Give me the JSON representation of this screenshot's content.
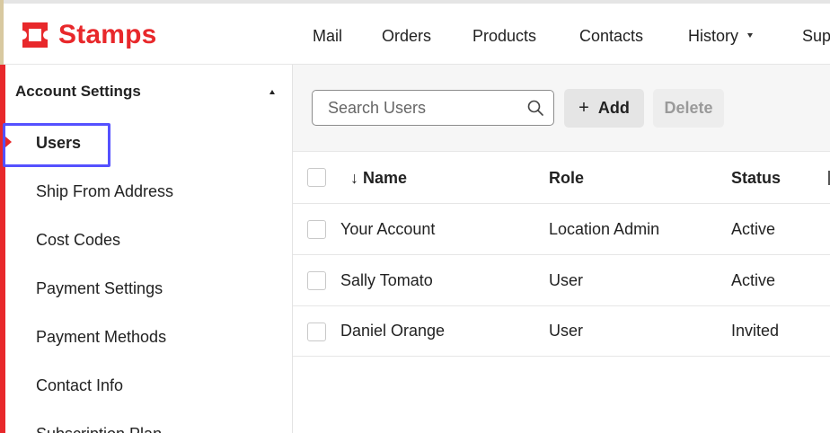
{
  "app": {
    "brand": "Stamps",
    "brand_color": "#e8282b",
    "logo_icon": "stamp-icon"
  },
  "nav": {
    "items": [
      "Mail",
      "Orders",
      "Products",
      "Contacts",
      "History",
      "Sup"
    ]
  },
  "sidebar": {
    "section_title": "Account Settings",
    "items": [
      "Users",
      "Ship From Address",
      "Cost Codes",
      "Payment Settings",
      "Payment Methods",
      "Contact Info",
      "Subscription Plan"
    ],
    "active_index": 0
  },
  "toolbar": {
    "search_placeholder": "Search Users",
    "add_label": "Add",
    "add_icon": "plus-icon",
    "delete_label": "Delete"
  },
  "table": {
    "sort_indicator": "↓",
    "columns": [
      "Name",
      "Role",
      "Status"
    ],
    "rows": [
      {
        "name": "Your Account",
        "role": "Location Admin",
        "status": "Active"
      },
      {
        "name": "Sally Tomato",
        "role": "User",
        "status": "Active"
      },
      {
        "name": "Daniel Orange",
        "role": "User",
        "status": "Invited"
      }
    ]
  },
  "colors": {
    "accent_red": "#e8282b",
    "highlight": "#5551ff"
  }
}
